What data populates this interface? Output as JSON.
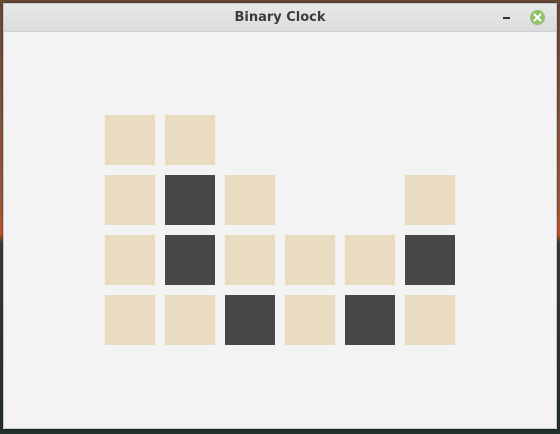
{
  "window": {
    "title": "Binary Clock"
  },
  "icons": {
    "minimize": "minimize-icon",
    "close": "close-icon"
  },
  "colors": {
    "bit_on": "#474747",
    "bit_off": "#e9dcc0",
    "background": "#f3f3f3",
    "close_button": "#8fc16a"
  },
  "binary_clock": {
    "column_bits": [
      [
        0,
        0,
        0,
        0
      ],
      [
        0,
        1,
        1,
        0
      ],
      [
        0,
        0,
        1
      ],
      [
        0,
        0
      ],
      [
        0,
        1
      ],
      [
        0,
        1,
        0
      ]
    ]
  }
}
